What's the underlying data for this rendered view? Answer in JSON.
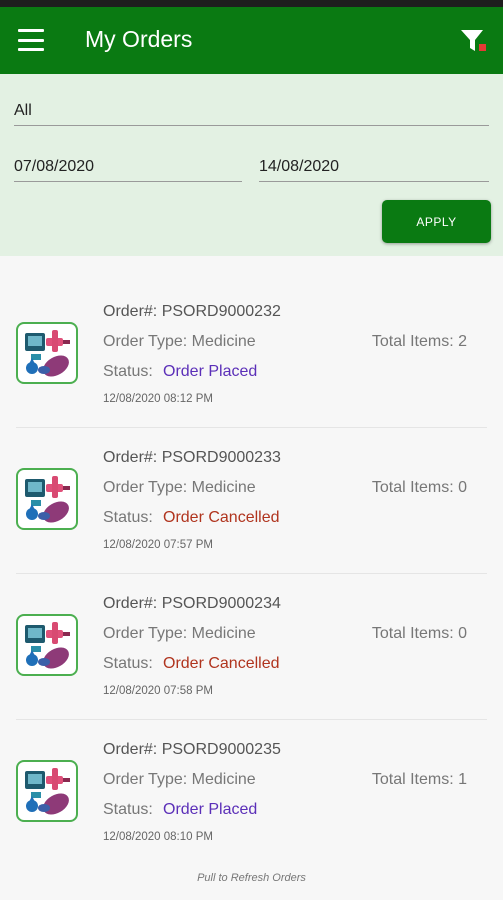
{
  "app_bar": {
    "title": "My Orders",
    "color": "#0a7a12",
    "menu_icon": "hamburger-menu-icon",
    "filter_icon": "filter-icon"
  },
  "filters": {
    "category_value": "All",
    "from_date": "07/08/2020",
    "to_date": "14/08/2020",
    "apply_label": "APPLY"
  },
  "orders": [
    {
      "order_label": "Order#: PSORD9000232",
      "type_label": "Order Type: Medicine",
      "items_label": "Total Items: 2",
      "status_prefix": "Status:",
      "status": "Order Placed",
      "status_color": "#5b2fb8",
      "timestamp": "12/08/2020 08:12 PM",
      "icon": "medicine-icon"
    },
    {
      "order_label": "Order#: PSORD9000233",
      "type_label": "Order Type: Medicine",
      "items_label": "Total Items: 0",
      "status_prefix": "Status:",
      "status": "Order Cancelled",
      "status_color": "#b0341e",
      "timestamp": "12/08/2020 07:57 PM",
      "icon": "medicine-icon"
    },
    {
      "order_label": "Order#: PSORD9000234",
      "type_label": "Order Type: Medicine",
      "items_label": "Total Items: 0",
      "status_prefix": "Status:",
      "status": "Order Cancelled",
      "status_color": "#b0341e",
      "timestamp": "12/08/2020 07:58 PM",
      "icon": "medicine-icon"
    },
    {
      "order_label": "Order#: PSORD9000235",
      "type_label": "Order Type: Medicine",
      "items_label": "Total Items: 1",
      "status_prefix": "Status:",
      "status": "Order Placed",
      "status_color": "#5b2fb8",
      "timestamp": "12/08/2020 08:10 PM",
      "icon": "medicine-icon"
    }
  ],
  "footer": {
    "refresh_hint": "Pull to Refresh Orders"
  }
}
